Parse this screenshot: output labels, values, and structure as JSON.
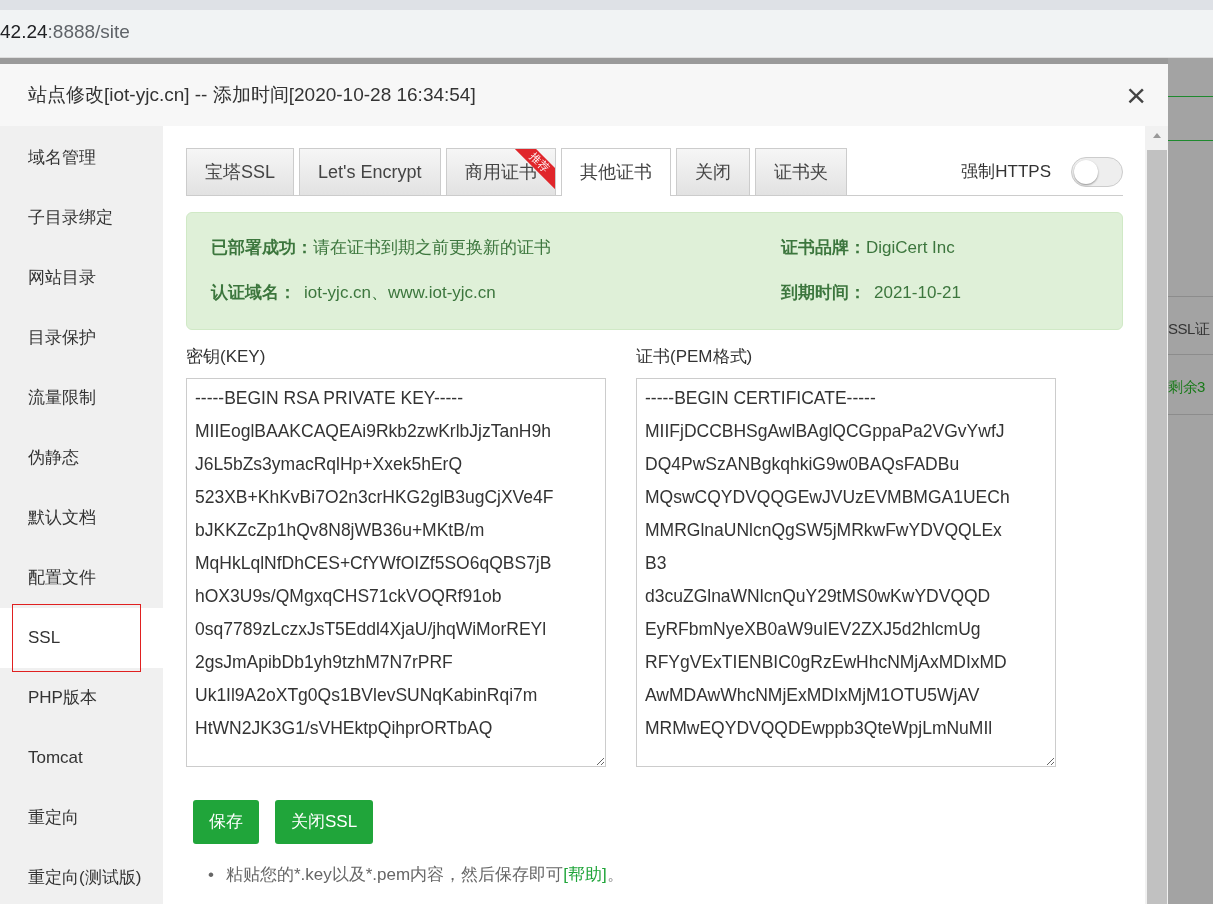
{
  "address_bar": {
    "host": "42.24",
    "rest": ":8888/site"
  },
  "background_page": {
    "texts": [
      "SSL证",
      "剩余3"
    ]
  },
  "modal": {
    "title": "站点修改[iot-yjc.cn] -- 添加时间[2020-10-28 16:34:54]",
    "close": "×"
  },
  "sidebar": {
    "items": [
      {
        "label": "域名管理",
        "selected": false
      },
      {
        "label": "子目录绑定",
        "selected": false
      },
      {
        "label": "网站目录",
        "selected": false
      },
      {
        "label": "目录保护",
        "selected": false
      },
      {
        "label": "流量限制",
        "selected": false
      },
      {
        "label": "伪静态",
        "selected": false
      },
      {
        "label": "默认文档",
        "selected": false
      },
      {
        "label": "配置文件",
        "selected": false
      },
      {
        "label": "SSL",
        "selected": true
      },
      {
        "label": "PHP版本",
        "selected": false
      },
      {
        "label": "Tomcat",
        "selected": false
      },
      {
        "label": "重定向",
        "selected": false
      },
      {
        "label": "重定向(测试版)",
        "selected": false
      }
    ]
  },
  "tabs": [
    {
      "label": "宝塔SSL",
      "selected": false
    },
    {
      "label": "Let's Encrypt",
      "selected": false
    },
    {
      "label": "商用证书",
      "selected": false,
      "ribbon": "推荐"
    },
    {
      "label": "其他证书",
      "selected": true
    },
    {
      "label": "关闭",
      "selected": false
    },
    {
      "label": "证书夹",
      "selected": false
    }
  ],
  "force_https": {
    "label": "强制HTTPS",
    "on": false
  },
  "status": {
    "deployed_label": "已部署成功：",
    "deployed_text": "请在证书到期之前更换新的证书",
    "domains_label": "认证域名：",
    "domains": "iot-yjc.cn、www.iot-yjc.cn",
    "brand_label": "证书品牌：",
    "brand": "DigiCert Inc",
    "expiry_label": "到期时间：",
    "expiry": "2021-10-21"
  },
  "key": {
    "label": "密钥(KEY)",
    "lines": [
      "-----BEGIN RSA PRIVATE KEY-----",
      "MIIEoglBAAKCAQEAi9Rkb2zwKrlbJjzTanH9h",
      "J6L5bZs3ymacRqlHp+Xxek5hErQ",
      "523XB+KhKvBi7O2n3crHKG2glB3ugCjXVe4F",
      "bJKKZcZp1hQv8N8jWB36u+MKtB/m",
      "MqHkLqlNfDhCES+CfYWfOIZf5SO6qQBS7jB",
      "hOX3U9s/QMgxqCHS71ckVOQRf91ob",
      "0sq7789zLczxJsT5Eddl4XjaU/jhqWiMorREYl",
      "2gsJmApibDb1yh9tzhM7N7rPRF",
      "Uk1Il9A2oXTg0Qs1BVlevSUNqKabinRqi7m",
      "HtWN2JK3G1/sVHEktpQihprORTbAQ"
    ]
  },
  "cert": {
    "label": "证书(PEM格式)",
    "lines": [
      "-----BEGIN CERTIFICATE-----",
      "MIIFjDCCBHSgAwlBAglQCGppaPa2VGvYwfJ",
      "DQ4PwSzANBgkqhkiG9w0BAQsFADBu",
      "MQswCQYDVQQGEwJVUzEVMBMGA1UECh",
      "MMRGlnaUNlcnQgSW5jMRkwFwYDVQQLEx",
      "B3",
      "d3cuZGlnaWNlcnQuY29tMS0wKwYDVQQD",
      "EyRFbmNyeXB0aW9uIEV2ZXJ5d2hlcmUg",
      "RFYgVExTIENBIC0gRzEwHhcNMjAxMDIxMD",
      "AwMDAwWhcNMjExMDIxMjM1OTU5WjAV",
      "MRMwEQYDVQQDEwppb3QteWpjLmNuMIl"
    ]
  },
  "buttons": [
    "保存",
    "关闭SSL"
  ],
  "note": {
    "bullet": "•",
    "text": "粘贴您的*.key以及*.pem内容，然后保存即可",
    "link": "[帮助]",
    "end": "。"
  }
}
